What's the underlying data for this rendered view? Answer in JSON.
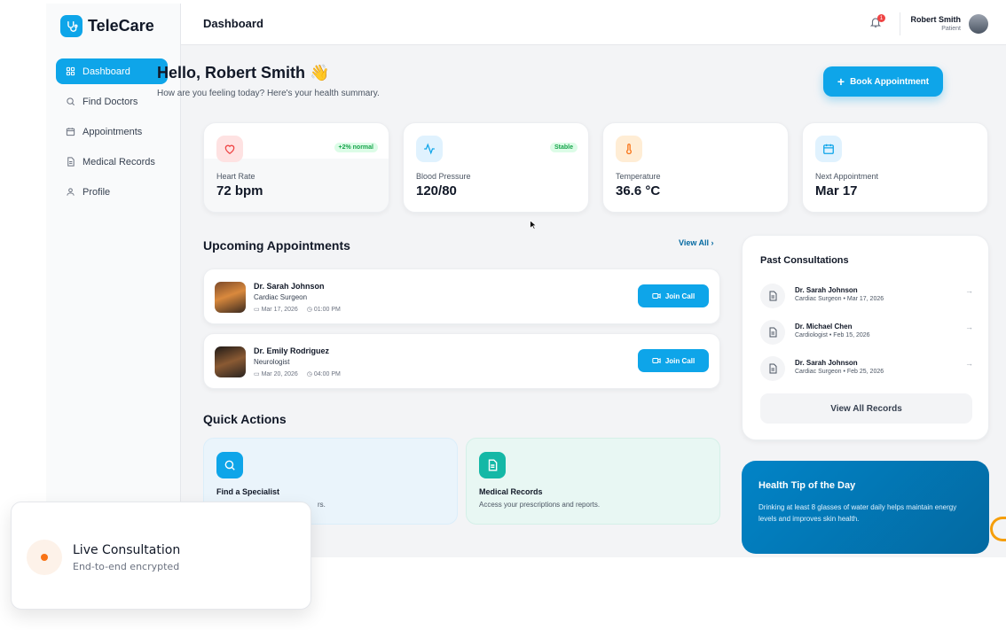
{
  "brand": {
    "name": "TeleCare",
    "icon": "stethoscope-icon"
  },
  "sidebar": {
    "items": [
      {
        "label": "Dashboard",
        "icon": "grid-icon",
        "active": true
      },
      {
        "label": "Find Doctors",
        "icon": "search-icon",
        "active": false
      },
      {
        "label": "Appointments",
        "icon": "calendar-icon",
        "active": false
      },
      {
        "label": "Medical Records",
        "icon": "document-icon",
        "active": false
      },
      {
        "label": "Profile",
        "icon": "user-icon",
        "active": false
      }
    ]
  },
  "header": {
    "title": "Dashboard",
    "notification_count": "1",
    "user_name": "Robert Smith",
    "user_role": "Patient"
  },
  "greeting": {
    "title": "Hello, Robert Smith",
    "emoji": "👋",
    "subtitle": "How are you feeling today? Here's your health summary."
  },
  "book_button": "Book Appointment",
  "stats": [
    {
      "label": "Heart Rate",
      "value": "72 bpm",
      "badge": "+2% normal",
      "icon": "heart-icon",
      "color": "#ef4444"
    },
    {
      "label": "Blood Pressure",
      "value": "120/80",
      "badge": "Stable",
      "icon": "activity-icon",
      "color": "#0ea5e9"
    },
    {
      "label": "Temperature",
      "value": "36.6 °C",
      "badge": "",
      "icon": "thermometer-icon",
      "color": "#f97316"
    },
    {
      "label": "Next Appointment",
      "value": "Mar 17",
      "badge": "",
      "icon": "calendar-icon",
      "color": "#0ea5e9"
    }
  ],
  "upcoming": {
    "title": "Upcoming Appointments",
    "view_all": "View All",
    "items": [
      {
        "doctor": "Dr. Sarah Johnson",
        "specialty": "Cardiac Surgeon",
        "date": "Mar 17, 2026",
        "time": "01:00 PM",
        "action": "Join Call"
      },
      {
        "doctor": "Dr. Emily Rodriguez",
        "specialty": "Neurologist",
        "date": "Mar 20, 2026",
        "time": "04:00 PM",
        "action": "Join Call"
      }
    ]
  },
  "quick_actions": {
    "title": "Quick Actions",
    "items": [
      {
        "title": "Find a Specialist",
        "desc": "rs.",
        "icon": "search-icon",
        "color": "#0ea5e9"
      },
      {
        "title": "Medical Records",
        "desc": "Access your prescriptions and reports.",
        "icon": "document-icon",
        "color": "#14b8a6"
      }
    ]
  },
  "past": {
    "title": "Past Consultations",
    "items": [
      {
        "doctor": "Dr. Sarah Johnson",
        "detail": "Cardiac Surgeon • Mar 17, 2026"
      },
      {
        "doctor": "Dr. Michael Chen",
        "detail": "Cardiologist • Feb 15, 2026"
      },
      {
        "doctor": "Dr. Sarah Johnson",
        "detail": "Cardiac Surgeon • Feb 25, 2026"
      }
    ],
    "button": "View All Records"
  },
  "tip": {
    "title": "Health Tip of the Day",
    "body": "Drinking at least 8 glasses of water daily helps maintain energy levels and improves skin health."
  },
  "toast": {
    "title": "Live Consultation",
    "subtitle": "End-to-end encrypted"
  },
  "colors": {
    "accent": "#0ea5e9",
    "success": "#16a34a",
    "tip_bg": "#0369a1"
  }
}
